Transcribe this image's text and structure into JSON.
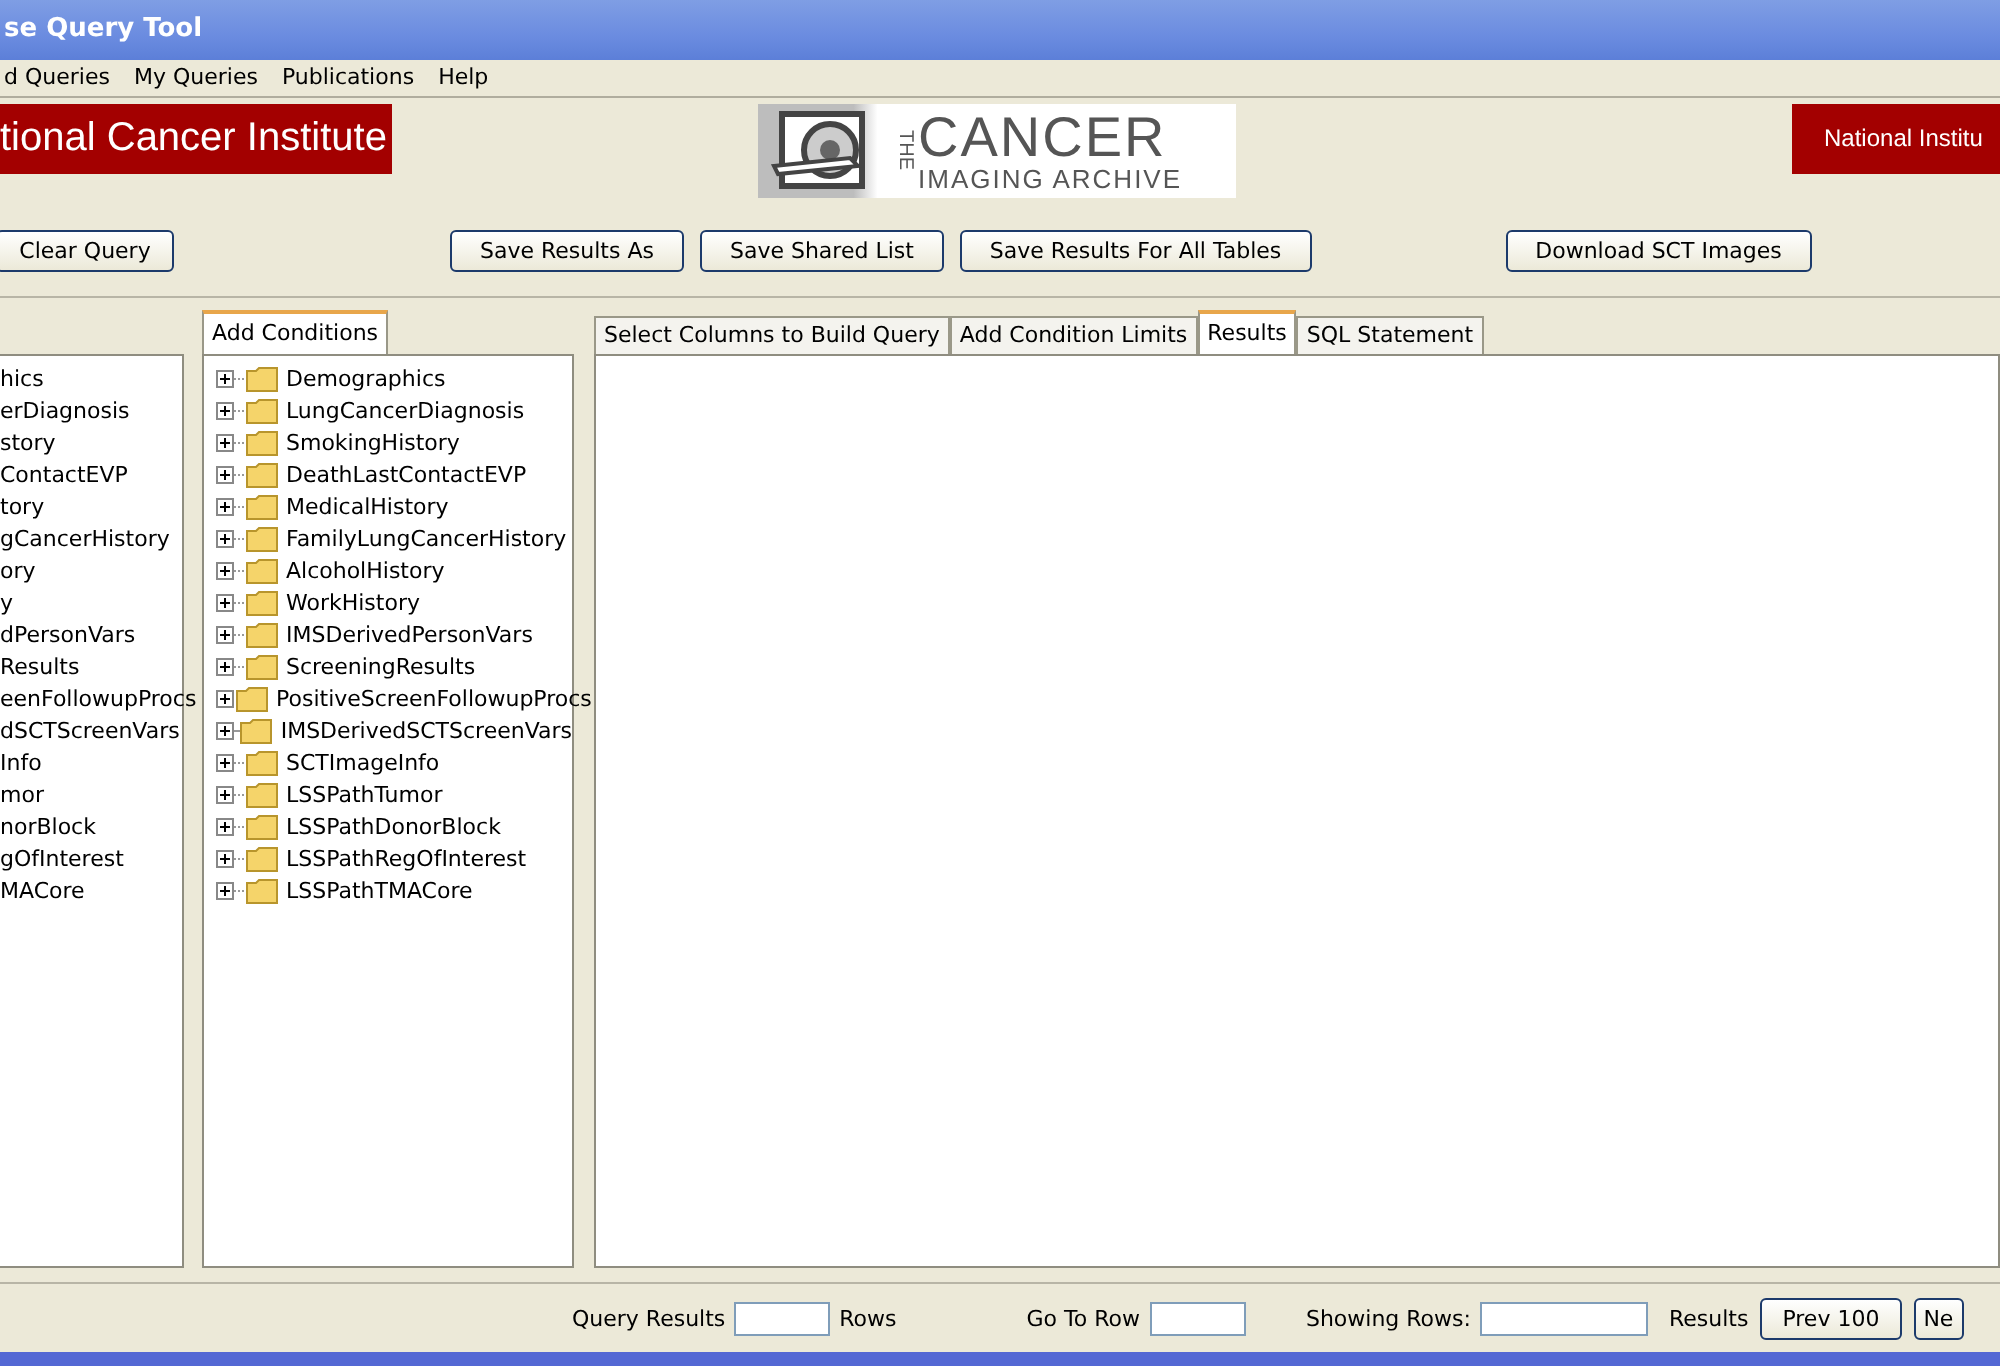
{
  "window": {
    "title": "se Query Tool"
  },
  "menu": [
    "d Queries",
    "My Queries",
    "Publications",
    "Help"
  ],
  "banner": {
    "left": "tional Cancer Institute",
    "logo_side": "THE",
    "logo_top": "CANCER",
    "logo_bottom": "IMAGING ARCHIVE",
    "right": "National Institu"
  },
  "toolbar": {
    "left": [
      "Clear Query"
    ],
    "middle": [
      "Save Results As",
      "Save Shared List",
      "Save Results For All Tables"
    ],
    "right": [
      "Download SCT Images"
    ]
  },
  "left_tree": {
    "items": [
      "hics",
      "erDiagnosis",
      "story",
      "ContactEVP",
      "tory",
      "gCancerHistory",
      "ory",
      "y",
      "dPersonVars",
      "Results",
      "eenFollowupProcs",
      "dSCTScreenVars",
      "Info",
      "mor",
      "norBlock",
      "gOfInterest",
      "MACore"
    ]
  },
  "conditions": {
    "tab": "Add Conditions",
    "items": [
      {
        "label": "Demographics",
        "expanded": false
      },
      {
        "label": "LungCancerDiagnosis",
        "expanded": false
      },
      {
        "label": "SmokingHistory",
        "expanded": false
      },
      {
        "label": "DeathLastContactEVP",
        "expanded": false
      },
      {
        "label": "MedicalHistory",
        "expanded": false
      },
      {
        "label": "FamilyLungCancerHistory",
        "expanded": false
      },
      {
        "label": "AlcoholHistory",
        "expanded": false
      },
      {
        "label": "WorkHistory",
        "expanded": false
      },
      {
        "label": "IMSDerivedPersonVars",
        "expanded": false
      },
      {
        "label": "ScreeningResults",
        "expanded": false
      },
      {
        "label": "PositiveScreenFollowupProcs",
        "expanded": false
      },
      {
        "label": "IMSDerivedSCTScreenVars",
        "expanded": false
      },
      {
        "label": "SCTImageInfo",
        "expanded": false
      },
      {
        "label": "LSSPathTumor",
        "expanded": false
      },
      {
        "label": "LSSPathDonorBlock",
        "expanded": false
      },
      {
        "label": "LSSPathRegOfInterest",
        "expanded": false
      },
      {
        "label": "LSSPathTMACore",
        "expanded": false
      }
    ]
  },
  "tabs": [
    {
      "label": "Select Columns to Build Query",
      "selected": false
    },
    {
      "label": "Add Condition Limits",
      "selected": false
    },
    {
      "label": "Results",
      "selected": true
    },
    {
      "label": "SQL Statement",
      "selected": false
    }
  ],
  "footer": {
    "query_results_label": "Query Results",
    "rows_label": "Rows",
    "go_to_row_label": "Go To Row",
    "showing_rows_label": "Showing Rows:",
    "results_label": "Results",
    "buttons": [
      "Prev 100",
      "Ne"
    ]
  }
}
